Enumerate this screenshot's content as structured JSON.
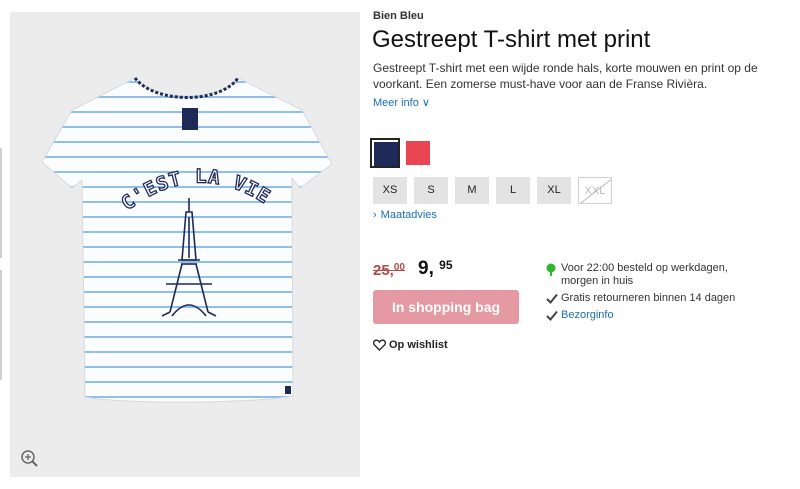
{
  "product": {
    "brand": "Bien Bleu",
    "title": "Gestreept T-shirt met print",
    "description": "Gestreept T-shirt met een wijde ronde hals, korte mouwen en print op de voorkant. Een zomerse must-have voor aan de Franse Rivièra.",
    "more_info": "Meer info ∨",
    "print_text": "C'EST LA VIE"
  },
  "colors": [
    {
      "name": "navy",
      "hex": "#1d2a57",
      "selected": true
    },
    {
      "name": "red",
      "hex": "#ea4652",
      "selected": false
    }
  ],
  "sizes": [
    {
      "label": "XS",
      "available": true
    },
    {
      "label": "S",
      "available": true
    },
    {
      "label": "M",
      "available": true
    },
    {
      "label": "L",
      "available": true
    },
    {
      "label": "XL",
      "available": true
    },
    {
      "label": "XXL",
      "available": false
    }
  ],
  "size_advice": "Maatadvies",
  "price": {
    "old_whole": "25,",
    "old_cents": "00",
    "new_whole": "9,",
    "new_cents": "95"
  },
  "buttons": {
    "add_to_bag": "In shopping bag",
    "wishlist": "Op wishlist"
  },
  "delivery": {
    "line1": "Voor 22:00 besteld op werkdagen,",
    "line2": "morgen in huis",
    "returns": "Gratis retourneren binnen 14 dagen",
    "shipping_info": "Bezorginfo"
  },
  "theme": {
    "accent_blue": "#1a6fb0",
    "old_price_red": "#b24b4b",
    "button_pink": "#e59aa3",
    "stripe_blue": "#8fc0ec",
    "check_green": "#2eb82e"
  },
  "icons": [
    "zoom-in-icon",
    "chevron-right-icon",
    "heart-outline-icon",
    "green-dot-icon",
    "check-icon"
  ]
}
